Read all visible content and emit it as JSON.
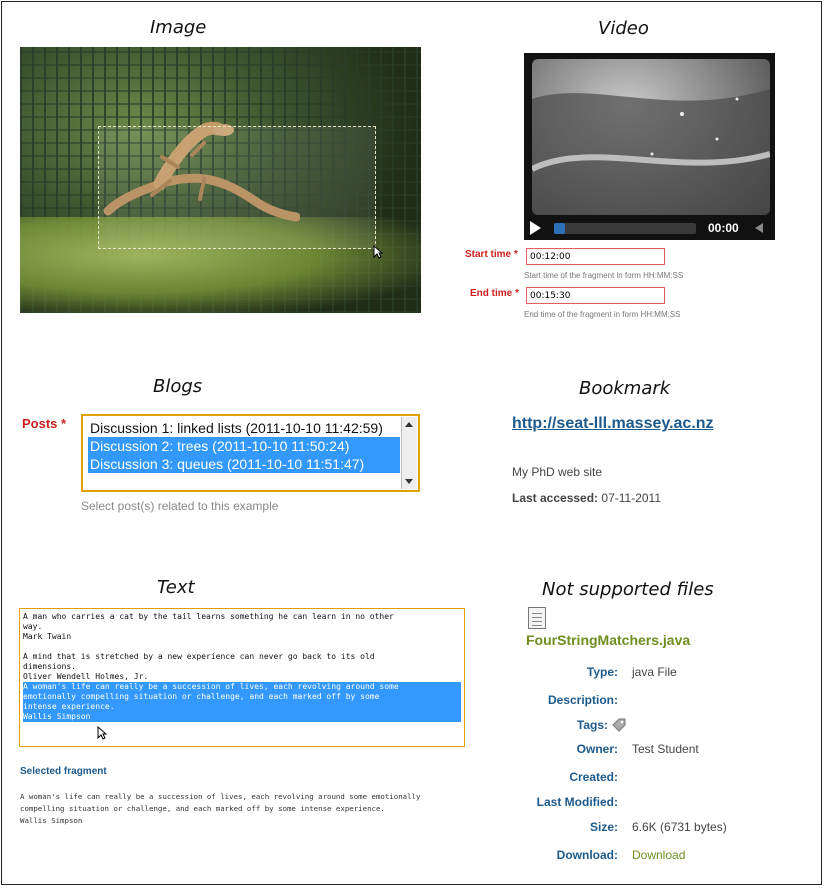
{
  "image_panel": {
    "title": "Image"
  },
  "video_panel": {
    "title": "Video",
    "time_display": "00:00",
    "progress": 0.08,
    "start_label": "Start time *",
    "start_value": "00:12:00",
    "start_hint": "Start time of the fragment in form HH:MM:SS",
    "end_label": "End time *",
    "end_value": "00:15:30",
    "end_hint": "End time of the fragment in form HH:MM:SS"
  },
  "blogs_panel": {
    "title": "Blogs",
    "posts_label": "Posts *",
    "options": [
      {
        "text": "Discussion 1: linked lists (2011-10-10 11:42:59)",
        "selected": false
      },
      {
        "text": "Discussion 2: trees (2011-10-10 11:50:24)",
        "selected": true
      },
      {
        "text": "Discussion 3: queues (2011-10-10 11:51:47)",
        "selected": true
      }
    ],
    "hint": "Select post(s) related to this example"
  },
  "bookmark_panel": {
    "title": "Bookmark",
    "url": "http://seat-lll.massey.ac.nz",
    "description": "My PhD web site",
    "last_accessed_label": "Last accessed:",
    "last_accessed_value": "07-11-2011"
  },
  "text_panel": {
    "title": "Text",
    "lines_normal": "A man who carries a cat by the tail learns something he can learn in no other\nway.\nMark Twain\n\nA mind that is stretched by a new experience can never go back to its old\ndimensions.\nOliver Wendell Holmes, Jr.\n",
    "lines_selected": "A woman's life can really be a succession of lives, each revolving around some\nemotionally compelling situation or challenge, and each marked off by some\nintense experience.\nWallis Simpson",
    "selected_fragment_label": "Selected fragment",
    "selected_fragment_text": "A woman's life can really be a succession of lives, each revolving around some emotionally\ncompelling situation or challenge, and each marked off by some intense experience.\nWallis Simpson"
  },
  "files_panel": {
    "title": "Not supported files",
    "filename": "FourStringMatchers.java",
    "type_label": "Type:",
    "type_value": "java File",
    "description_label": "Description:",
    "tags_label": "Tags:",
    "owner_label": "Owner:",
    "owner_value": "Test Student",
    "created_label": "Created:",
    "modified_label": "Last Modified:",
    "size_label": "Size:",
    "size_value": "6.6K (6731 bytes)",
    "download_label": "Download:",
    "download_link": "Download"
  }
}
